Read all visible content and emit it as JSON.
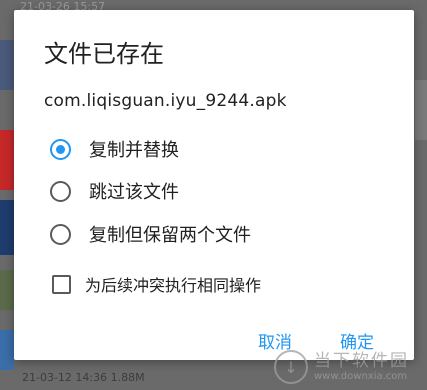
{
  "background": {
    "top_text": "21-03-26 15:57",
    "bottom_text": "21-03-12 14:36  1.88M",
    "colors": {
      "strip_red": "#c62828",
      "strip_blue": "#1e3c6e",
      "dim": "#6a6a6a"
    }
  },
  "dialog": {
    "title": "文件已存在",
    "filename": "com.liqisguan.iyu_9244.apk",
    "options": [
      {
        "label": "复制并替换",
        "checked": true
      },
      {
        "label": "跳过该文件",
        "checked": false
      },
      {
        "label": "复制但保留两个文件",
        "checked": false
      }
    ],
    "checkbox": {
      "label": "为后续冲突执行相同操作",
      "checked": false
    },
    "buttons": {
      "cancel": "取消",
      "ok": "确定"
    },
    "accent_color": "#2196f3"
  },
  "watermark": {
    "cn": "当下软件园",
    "en": "www.downxia.com"
  }
}
